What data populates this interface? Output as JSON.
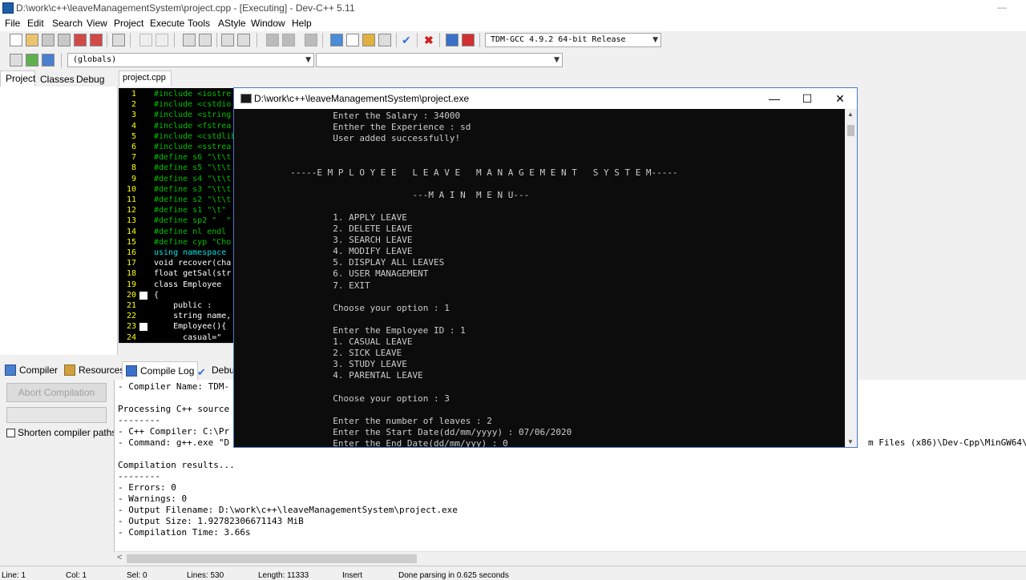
{
  "window": {
    "title": "D:\\work\\c++\\leaveManagementSystem\\project.cpp - [Executing] - Dev-C++ 5.11"
  },
  "menu": [
    "File",
    "Edit",
    "Search",
    "View",
    "Project",
    "Execute",
    "Tools",
    "AStyle",
    "Window",
    "Help"
  ],
  "toolbar": {
    "compiler_select": "TDM-GCC 4.9.2 64-bit Release",
    "scope_select": "(globals)",
    "function_select": ""
  },
  "left_tabs": [
    "Project",
    "Classes",
    "Debug"
  ],
  "editor": {
    "file_tab": "project.cpp",
    "lines": [
      {
        "n": "1",
        "text": "#include <iostre",
        "color": "#00c000"
      },
      {
        "n": "2",
        "text": "#include <cstdio",
        "color": "#00c000"
      },
      {
        "n": "3",
        "text": "#include <string",
        "color": "#00c000"
      },
      {
        "n": "4",
        "text": "#include <fstrea",
        "color": "#00c000"
      },
      {
        "n": "5",
        "text": "#include <cstdlib",
        "color": "#00c000"
      },
      {
        "n": "6",
        "text": "#include <sstrea",
        "color": "#00c000"
      },
      {
        "n": "7",
        "text": "#define s6 \"\\t\\t",
        "color": "#00c000"
      },
      {
        "n": "8",
        "text": "#define s5 \"\\t\\t",
        "color": "#00c000"
      },
      {
        "n": "9",
        "text": "#define s4 \"\\t\\t",
        "color": "#00c000"
      },
      {
        "n": "10",
        "text": "#define s3 \"\\t\\t",
        "color": "#00c000"
      },
      {
        "n": "11",
        "text": "#define s2 \"\\t\\t",
        "color": "#00c000"
      },
      {
        "n": "12",
        "text": "#define s1 \"\\t\"",
        "color": "#00c000"
      },
      {
        "n": "13",
        "text": "#define sp2 \"  \"",
        "color": "#00c000"
      },
      {
        "n": "14",
        "text": "#define nl endl",
        "color": "#00c000"
      },
      {
        "n": "15",
        "text": "#define cyp \"Cho",
        "color": "#00c000"
      },
      {
        "n": "16",
        "text": "using namespace",
        "color": "#00e0e0"
      },
      {
        "n": "17",
        "text": "void recover(cha",
        "color": "#ffffff"
      },
      {
        "n": "18",
        "text": "float getSal(str",
        "color": "#ffffff"
      },
      {
        "n": "19",
        "text": "class Employee",
        "color": "#ffffff"
      },
      {
        "n": "20",
        "text": "{",
        "color": "#ffffff"
      },
      {
        "n": "21",
        "text": "    public :",
        "color": "#ffffff"
      },
      {
        "n": "22",
        "text": "    string name,",
        "color": "#ffffff"
      },
      {
        "n": "23",
        "text": "    Employee(){",
        "color": "#ffffff"
      },
      {
        "n": "24",
        "text": "      casual=\"",
        "color": "#ffffff"
      }
    ]
  },
  "bottom_tabs": [
    "Compiler",
    "Resources",
    "Compile Log",
    "Debu"
  ],
  "compiler_panel": {
    "abort_label": "Abort Compilation",
    "shorten_label": "Shorten compiler paths",
    "log": [
      "- Compiler Name: TDM-",
      "",
      "Processing C++ source",
      "--------",
      "- C++ Compiler: C:\\Pr",
      "- Command: g++.exe \"D",
      "",
      "Compilation results...",
      "--------",
      "- Errors: 0",
      "- Warnings: 0",
      "- Output Filename: D:\\work\\c++\\leaveManagementSystem\\project.exe",
      "- Output Size: 1.92782306671143 MiB",
      "- Compilation Time: 3.66s"
    ],
    "log_right_fragment": "m Files (x86)\\Dev-Cpp\\MinGW64\\"
  },
  "status": {
    "line": "Line: 1",
    "col": "Col: 1",
    "sel": "Sel: 0",
    "lines": "Lines: 530",
    "length": "Length: 11333",
    "mode": "Insert",
    "message": "Done parsing in 0.625 seconds"
  },
  "console": {
    "title": "D:\\work\\c++\\leaveManagementSystem\\project.exe",
    "lines": [
      "                  Enter the Salary : 34000",
      "                  Enther the Experience : sd",
      "                  User added successfully!",
      "",
      "",
      "          -----E M P L O Y E E   L E A V E   M A N A G E M E N T   S Y S T E M-----",
      "",
      "                                 ---M A I N  M E N U---",
      "",
      "                  1. APPLY LEAVE",
      "                  2. DELETE LEAVE",
      "                  3. SEARCH LEAVE",
      "                  4. MODIFY LEAVE",
      "                  5. DISPLAY ALL LEAVES",
      "                  6. USER MANAGEMENT",
      "                  7. EXIT",
      "",
      "                  Choose your option : 1",
      "",
      "                  Enter the Employee ID : 1",
      "                  1. CASUAL LEAVE",
      "                  2. SICK LEAVE",
      "                  3. STUDY LEAVE",
      "                  4. PARENTAL LEAVE",
      "",
      "                  Choose your option : 3",
      "",
      "                  Enter the number of leaves : 2",
      "                  Enter the Start Date(dd/mm/yyyy) : 07/06/2020",
      "                  Enter the End Date(dd/mm/yyy) : 0"
    ]
  }
}
